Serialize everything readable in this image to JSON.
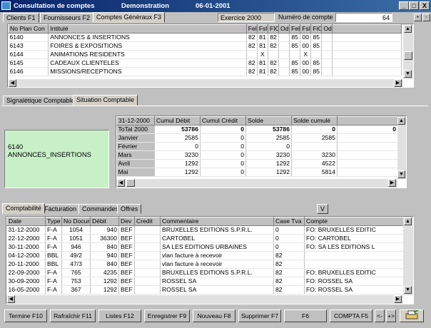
{
  "window": {
    "title": "Consultation de comptes",
    "company": "Demonstration",
    "date": "06-01-2001",
    "minimize": "_",
    "maximize": "□",
    "close": "X"
  },
  "top_tabs": [
    {
      "label": "Clients  F1"
    },
    {
      "label": "Fournisseurs  F2"
    },
    {
      "label": "Comptes Généraux  F3"
    }
  ],
  "header": {
    "exercice": "Exercice 2000",
    "numero_label": "Numéro de compte",
    "numero_value": "64"
  },
  "accounts": {
    "columns": [
      "No Plan Con",
      "Intitulé",
      "Fel",
      "Fsl",
      "FIC",
      "Od",
      "Fel",
      "Fsl",
      "FiC",
      "Od"
    ],
    "rows": [
      {
        "no": "6140",
        "name": "ANNONCES & INSERTIONS",
        "c": [
          "82",
          "81",
          "82",
          "",
          "85",
          "00",
          "85",
          ""
        ]
      },
      {
        "no": "6143",
        "name": "FOIRES & EXPOSITIONS",
        "c": [
          "82",
          "81",
          "82",
          "",
          "85",
          "00",
          "85",
          ""
        ]
      },
      {
        "no": "6144",
        "name": "ANIMATIONS RESIDENTS",
        "c": [
          "",
          "X",
          "",
          "",
          "",
          "X",
          "",
          ""
        ]
      },
      {
        "no": "6145",
        "name": "CADEAUX CLIENTELES",
        "c": [
          "82",
          "81",
          "82",
          "",
          "85",
          "00",
          "85",
          ""
        ]
      },
      {
        "no": "6146",
        "name": "MISSIONS/RECEPTIONS",
        "c": [
          "82",
          "81",
          "82",
          "",
          "85",
          "00",
          "85",
          ""
        ]
      }
    ]
  },
  "mid_tabs": [
    {
      "label": "Signalétique Comptable"
    },
    {
      "label": "Situation Comptable"
    }
  ],
  "account_box": {
    "number": "6140",
    "name": "ANNONCES_INSERTIONS"
  },
  "situation": {
    "columns": [
      "31-12-2000",
      "Cumul Débit",
      "Cumul Crédit",
      "Solde",
      "Solde cumulé",
      ""
    ],
    "rows": [
      {
        "p": "ToTal 2000",
        "d": "53786",
        "c": "0",
        "s": "53786",
        "sc": "0",
        "x": "0",
        "bold": true
      },
      {
        "p": "Janvier",
        "d": "2585",
        "c": "0",
        "s": "2585",
        "sc": "2585",
        "x": ""
      },
      {
        "p": "Février",
        "d": "0",
        "c": "0",
        "s": "0",
        "sc": "",
        "x": ""
      },
      {
        "p": "Mars",
        "d": "3230",
        "c": "0",
        "s": "3230",
        "sc": "3230",
        "x": ""
      },
      {
        "p": "Avril",
        "d": "1292",
        "c": "0",
        "s": "1292",
        "sc": "4522",
        "x": ""
      },
      {
        "p": "Mai",
        "d": "1292",
        "c": "0",
        "s": "1292",
        "sc": "5814",
        "x": ""
      }
    ]
  },
  "bottom_tabs": [
    {
      "label": "Comptabilité"
    },
    {
      "label": "Facturation"
    },
    {
      "label": "Commandes"
    },
    {
      "label": "Offres"
    }
  ],
  "v_button": "V",
  "entries": {
    "columns": [
      "Date",
      "Type",
      "No Docun",
      "Débit",
      "Dev",
      "Credit",
      "Commentaire",
      "Case Tva",
      "Compte"
    ],
    "rows": [
      {
        "date": "31-12-2000",
        "type": "F-A",
        "doc": "1054",
        "debit": "940",
        "dev": "BEF",
        "credit": "",
        "comment": "BRUXELLES EDITIONS S.P.R.L.",
        "tva": "0",
        "compte": "FO: BRUXELLES EDITIC"
      },
      {
        "date": "22-12-2000",
        "type": "F-A",
        "doc": "1051",
        "debit": "36300",
        "dev": "BEF",
        "credit": "",
        "comment": "CARTOBEL",
        "tva": "0",
        "compte": "FO: CARTOBEL"
      },
      {
        "date": "30-11-2000",
        "type": "F-A",
        "doc": "946",
        "debit": "840",
        "dev": "BEF",
        "credit": "",
        "comment": "SA LES EDITIONS URBAINES",
        "tva": "0",
        "compte": "FO: SA LES EDITIONS L"
      },
      {
        "date": "04-12-2000",
        "type": "BBL",
        "doc": "49/2",
        "debit": "940",
        "dev": "BEF",
        "credit": "",
        "comment": "vlan facture à recevoir",
        "tva": "82",
        "compte": ""
      },
      {
        "date": "20-11-2000",
        "type": "BBL",
        "doc": "47/3",
        "debit": "840",
        "dev": "BEF",
        "credit": "",
        "comment": "vlan facture à recevoir",
        "tva": "82",
        "compte": ""
      },
      {
        "date": "22-09-2000",
        "type": "F-A",
        "doc": "765",
        "debit": "4235",
        "dev": "BEF",
        "credit": "",
        "comment": "BRUXELLES EDITIONS S.P.R.L.",
        "tva": "82",
        "compte": "FO: BRUXELLES EDITIC"
      },
      {
        "date": "30-09-2000",
        "type": "F-A",
        "doc": "753",
        "debit": "1292",
        "dev": "BEF",
        "credit": "",
        "comment": "ROSSEL SA",
        "tva": "82",
        "compte": "FO: ROSSEL SA"
      },
      {
        "date": "16-05-2000",
        "type": "F-A",
        "doc": "367",
        "debit": "1292",
        "dev": "BEF",
        "credit": "",
        "comment": "ROSSEL SA",
        "tva": "82",
        "compte": "FO: ROSSEL SA"
      }
    ]
  },
  "toolbar": {
    "termine": "Termine  F10",
    "rafraichir": "Rafraîchir F11",
    "listes": "Listes    F12",
    "enregistrer": "Enregistrer F9",
    "nouveau": "Nouveau F8",
    "supprimer": "Supprimer  F7",
    "f6": "F6",
    "compta": "COMPTA F5",
    "prev": "<-",
    "next": "+>"
  }
}
